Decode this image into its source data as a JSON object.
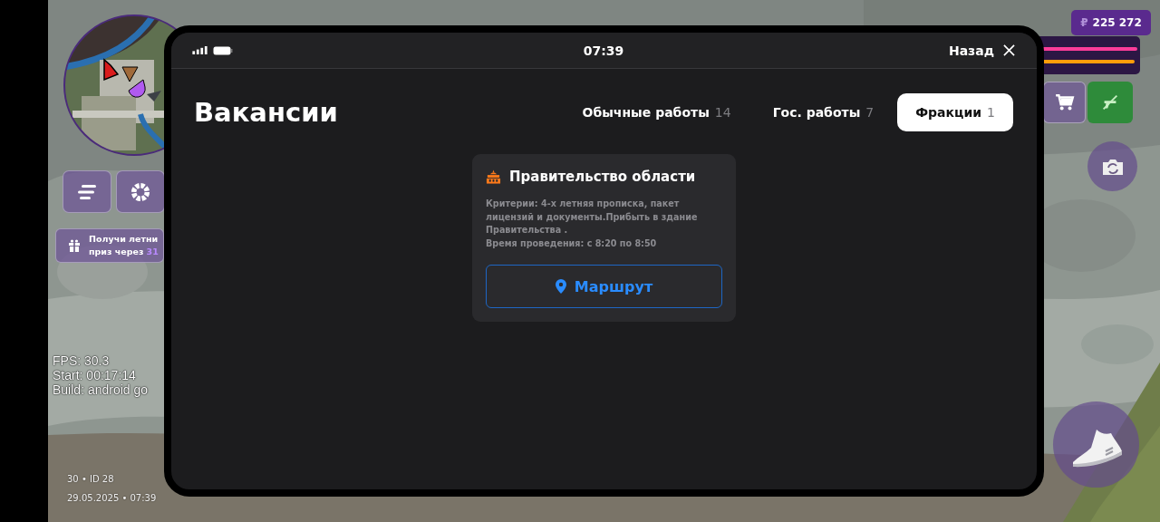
{
  "hud": {
    "gift_banner": {
      "line_1": "Получи летни",
      "line_2": "приз через",
      "highlight": "31"
    },
    "debug": [
      "FPS: 30.3",
      "Start: 00:17:14",
      "Build: android go"
    ],
    "footer": [
      "30 • ID 28",
      "29.05.2025 • 07:39"
    ],
    "money": {
      "currency": "₽",
      "amount": "225 272"
    },
    "bars": [
      {
        "color": "#ff3d9a",
        "level": 0.97
      },
      {
        "color": "#ff9d0a",
        "level": 0.95
      }
    ]
  },
  "phone": {
    "status_bar": {
      "time": "07:39",
      "back": "Назад"
    },
    "title": "Вакансии",
    "tabs": [
      {
        "label": "Обычные работы",
        "count": "14",
        "selected": false
      },
      {
        "label": "Гос. работы",
        "count": "7",
        "selected": false
      },
      {
        "label": "Фракции",
        "count": "1",
        "selected": true
      }
    ],
    "cards": [
      {
        "title": "Правительство области",
        "criteria": "Критерии:  4-х летняя прописка, пакет лицензий и документы.Прибыть в здание Правительства .",
        "schedule": "Время проведения: с 8:20 по 8:50",
        "button": "Маршрут"
      }
    ]
  }
}
